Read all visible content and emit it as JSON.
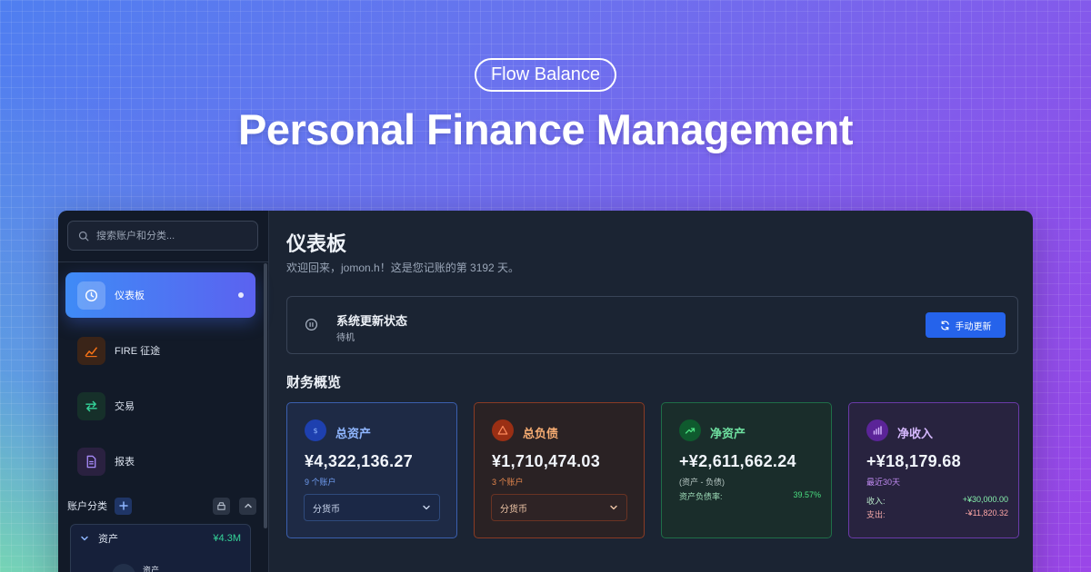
{
  "hero": {
    "badge": "Flow Balance",
    "title": "Personal Finance Management"
  },
  "sidebar": {
    "search_placeholder": "搜索账户和分类...",
    "items": [
      {
        "label": "仪表板",
        "icon": "clock-icon",
        "active": true
      },
      {
        "label": "FIRE 征途",
        "icon": "trend-chart-icon",
        "active": false
      },
      {
        "label": "交易",
        "icon": "swap-arrows-icon",
        "active": false
      },
      {
        "label": "报表",
        "icon": "document-icon",
        "active": false
      }
    ],
    "accounts": {
      "header": "账户分类",
      "group_name": "资产",
      "group_amount": "¥4.3M",
      "sub_item": "资产"
    }
  },
  "main": {
    "title": "仪表板",
    "welcome": "欢迎回来，jomon.h！这是您记账的第 3192 天。",
    "status": {
      "title": "系统更新状态",
      "state": "待机",
      "button": "手动更新"
    },
    "overview_title": "财务概览",
    "cards": {
      "assets": {
        "title": "总资产",
        "value": "¥4,322,136.27",
        "sub": "9 个账户",
        "select": "分货币"
      },
      "liabilities": {
        "title": "总负债",
        "value": "¥1,710,474.03",
        "sub": "3 个账户",
        "select": "分货币"
      },
      "net_worth": {
        "title": "净资产",
        "value": "+¥2,611,662.24",
        "sub": "(资产 - 负债)",
        "ratio_label": "资产负债率:",
        "ratio_value": "39.57%"
      },
      "net_income": {
        "title": "净收入",
        "value": "+¥18,179.68",
        "sub": "最近30天",
        "income_label": "收入:",
        "income_value": "+¥30,000.00",
        "expense_label": "支出:",
        "expense_value": "-¥11,820.32"
      }
    }
  },
  "colors": {
    "accent": "#2563eb",
    "positive": "#34d399",
    "negative": "#f87171"
  }
}
